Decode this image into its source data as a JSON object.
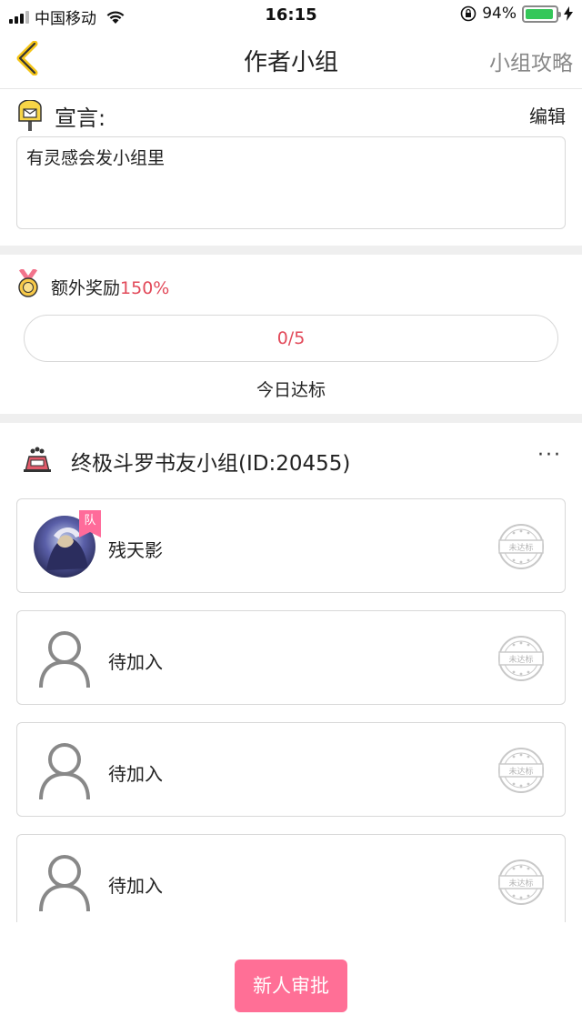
{
  "status_bar": {
    "carrier": "中国移动",
    "time": "16:15",
    "battery_percent": "94%",
    "battery_level": 0.94,
    "icons": [
      "signal-icon",
      "wifi-icon",
      "rotation-lock-icon",
      "battery-icon",
      "charging-icon"
    ]
  },
  "nav": {
    "back_icon": "chevron-left-icon",
    "title": "作者小组",
    "right_link": "小组攻略"
  },
  "manifesto": {
    "icon": "mailbox-icon",
    "label": "宣言:",
    "edit": "编辑",
    "text": "有灵感会发小组里"
  },
  "bonus": {
    "icon": "medal-icon",
    "label": "额外奖励",
    "percent": "150%",
    "progress_text": "0/5",
    "progress_fraction": 0,
    "status": "今日达标"
  },
  "group": {
    "icon": "group-icon",
    "title": "终极斗罗书友小组(ID:20455)",
    "more": "···",
    "members": [
      {
        "name": "残天影",
        "avatar": "user-avatar-photo",
        "badge": "队",
        "stamp": "未达标"
      },
      {
        "name": "待加入",
        "avatar": "empty-user-icon",
        "stamp": "未达标"
      },
      {
        "name": "待加入",
        "avatar": "empty-user-icon",
        "stamp": "未达标"
      },
      {
        "name": "待加入",
        "avatar": "empty-user-icon",
        "stamp": "未达标"
      }
    ]
  },
  "footer": {
    "button": "新人审批"
  },
  "colors": {
    "accent_pink": "#ff6f96",
    "percent_red": "#e24a5a",
    "back_yellow": "#f5c518",
    "battery_green": "#34c759"
  }
}
